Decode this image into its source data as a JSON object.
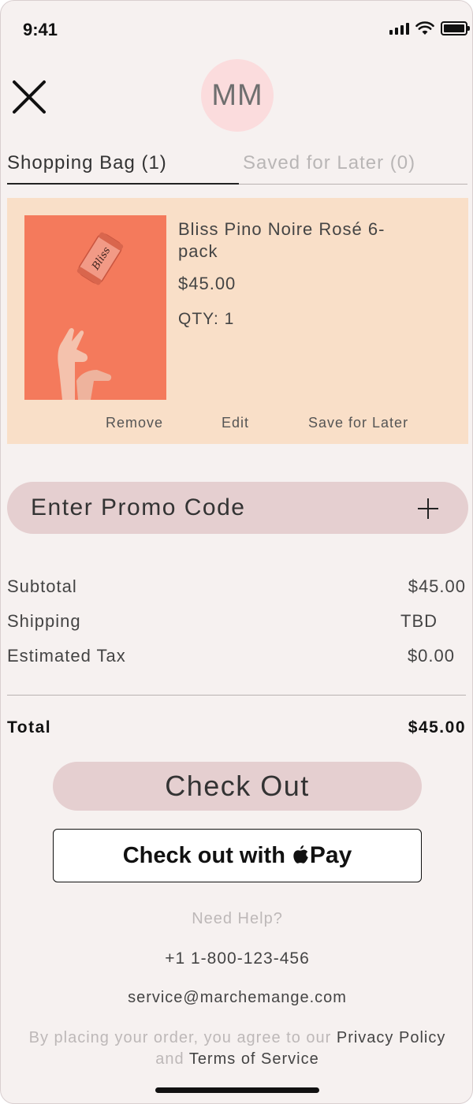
{
  "status_bar": {
    "time": "9:41"
  },
  "header": {
    "avatar_initials": "MM"
  },
  "tabs": [
    {
      "label": "Shopping Bag (1)",
      "active": true
    },
    {
      "label": "Saved for Later (0)",
      "active": false
    }
  ],
  "cart_item": {
    "name": "Bliss Pino Noire Rosé 6-pack",
    "price": "$45.00",
    "qty": "QTY: 1",
    "can_script": "Bliss",
    "actions": {
      "remove": "Remove",
      "edit": "Edit",
      "save_for_later": "Save for Later"
    }
  },
  "promo": {
    "label": "Enter Promo Code"
  },
  "summary": {
    "subtotal_label": "Subtotal",
    "subtotal_value": "$45.00",
    "shipping_label": "Shipping",
    "shipping_value": "TBD",
    "tax_label": "Estimated Tax",
    "tax_value": "$0.00",
    "total_label": "Total",
    "total_value": "$45.00"
  },
  "buttons": {
    "checkout": "Check Out",
    "apple_pay_prefix": "Check out with",
    "apple_pay_brand": "Pay"
  },
  "help": {
    "title": "Need Help?",
    "phone": "+1 1-800-123-456",
    "email": "service@marchemange.com"
  },
  "legal": {
    "prefix": "By placing your order, you agree to our",
    "privacy": "Privacy Policy",
    "and": "and",
    "terms": "Terms of Service"
  },
  "colors": {
    "background": "#f6f1f0",
    "card": "#f9dfc8",
    "pill": "#e5cfd0",
    "avatar": "#fbdcdd",
    "product_bg": "#f47a5c"
  }
}
